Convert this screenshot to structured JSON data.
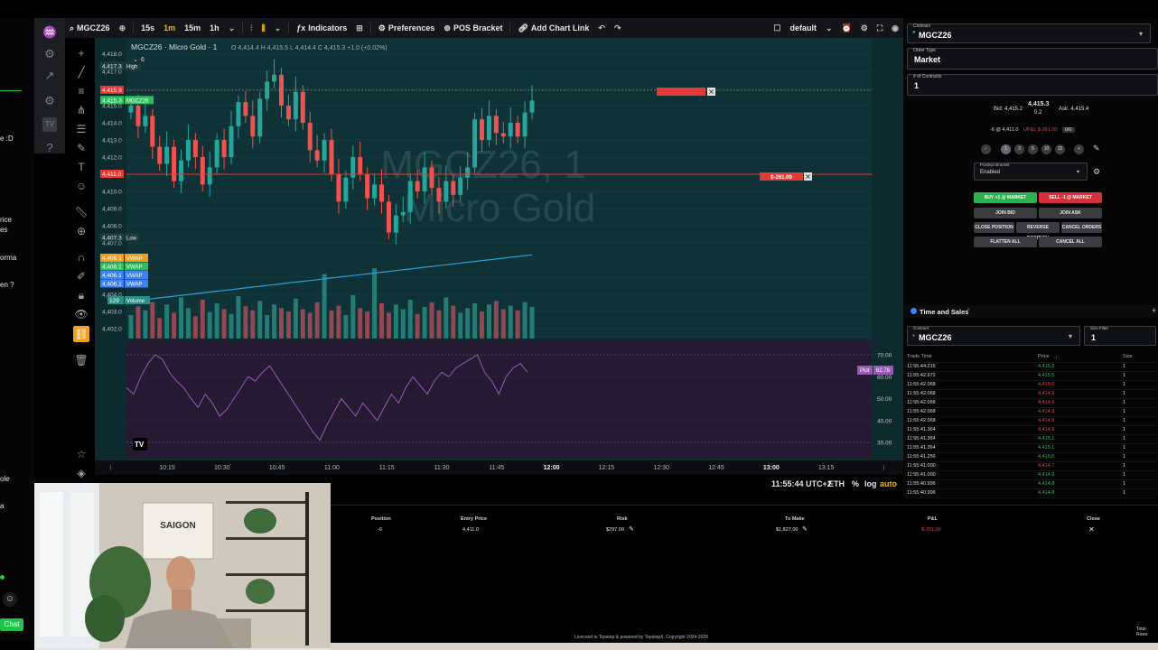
{
  "left_strip": {
    "fragments": [
      "e :D",
      "rice",
      "es",
      "orma",
      "en ?",
      "ole",
      "a"
    ],
    "chat_label": "Chat",
    "emoji": "☺"
  },
  "toolbar": {
    "symbol": "MGCZ26",
    "intervals": [
      "15s",
      "1m",
      "15m",
      "1h"
    ],
    "active_interval": "1m",
    "indicators_label": "Indicators",
    "preferences_label": "Preferences",
    "pos_bracket_label": "POS Bracket",
    "add_chart_link_label": "Add Chart Link",
    "layout_name": "default"
  },
  "chart": {
    "legend_title": "MGCZ26 · Micro Gold · 1",
    "ohlc": "O 4,414.4  H 4,415.5  L 4,414.4  C 4,415.3  +1.0 (+0.02%)",
    "indicator_count": "6",
    "watermark_line1": "MGCZ26, 1",
    "watermark_line2": "Micro Gold",
    "price_ticks": [
      "4,418.0",
      "4,417.0",
      "4,416.0",
      "4,415.0",
      "4,414.0",
      "4,413.0",
      "4,412.0",
      "4,411.0",
      "4,410.0",
      "4,409.0",
      "4,408.0",
      "4,407.0",
      "4,406.0",
      "4,405.0",
      "4,404.0",
      "4,403.0",
      "4,402.0"
    ],
    "top_tick": "4,418.0",
    "high_label": "4,417.3",
    "high_text": "High",
    "low_label": "4,407.3",
    "low_text": "Low",
    "order_label": "4,415.9",
    "last_price": "4,415.3",
    "last_symbol": "MGCZ26",
    "position_price": "4,411.0",
    "pnl_tag": "$-261.00",
    "vwap_tags": [
      {
        "value": "4,406.1",
        "label": "VWAP",
        "color": "#f29d1d"
      },
      {
        "value": "4,406.1",
        "label": "VWAP",
        "color": "#2ebd5f"
      },
      {
        "value": "4,406.1",
        "label": "VWAP",
        "color": "#3b82f6"
      },
      {
        "value": "4,406.1",
        "label": "VWAP",
        "color": "#3b82f6"
      }
    ],
    "volume_tag": {
      "value": "129",
      "label": "Volume"
    },
    "rsi": {
      "label": "Plot",
      "value": "62.78",
      "ticks": [
        "70.00",
        "60.00",
        "50.00",
        "40.00",
        "30.00"
      ]
    },
    "time_ticks": [
      "10:15",
      "10:30",
      "10:45",
      "11:00",
      "11:15",
      "11:30",
      "11:45",
      "12:00",
      "12:15",
      "12:30",
      "12:45",
      "13:00",
      "13:15"
    ],
    "bold_time": "12:00",
    "bold_time_2": "13:00",
    "status": {
      "clock": "11:55:44 UTC+2",
      "session": "ETH",
      "percent": "%",
      "log": "log",
      "auto": "auto"
    },
    "colors": {
      "up": "#26a69a",
      "down": "#ef5350",
      "vwap": "#2e9fd8",
      "rsi": "#9b59b6"
    },
    "candles": {
      "opens": [
        4414.6,
        4415.0,
        4413.8,
        4414.4,
        4412.6,
        4411.6,
        4412.6,
        4410.6,
        4411.8,
        4413.0,
        4412.0,
        4410.4,
        4411.4,
        4413.0,
        4412.0,
        4413.8,
        4415.2,
        4414.4,
        4413.2,
        4415.4,
        4416.4,
        4416.8,
        4415.0,
        4414.2,
        4415.8,
        4414.0,
        4412.4,
        4411.8,
        4413.0,
        4411.0,
        4409.4,
        4410.8,
        4412.0,
        4411.0,
        4409.6,
        4410.4,
        4409.4,
        4407.6,
        4408.6,
        4408.8,
        4410.6,
        4410.0,
        4411.4,
        4410.2,
        4409.4,
        4410.6,
        4409.8,
        4410.8,
        4411.4,
        4414.2,
        4413.0,
        4414.4,
        4413.4,
        4413.2,
        4414.0,
        4413.2,
        4414.6
      ],
      "closes": [
        4415.0,
        4413.8,
        4414.4,
        4412.6,
        4411.6,
        4412.6,
        4410.6,
        4411.8,
        4413.0,
        4412.0,
        4410.4,
        4411.4,
        4413.0,
        4412.0,
        4413.8,
        4415.2,
        4414.4,
        4413.2,
        4415.4,
        4416.4,
        4416.8,
        4415.0,
        4414.2,
        4415.8,
        4414.0,
        4412.4,
        4411.8,
        4413.0,
        4411.0,
        4409.4,
        4410.8,
        4412.0,
        4411.0,
        4409.6,
        4410.4,
        4409.4,
        4407.6,
        4408.6,
        4408.8,
        4410.6,
        4410.0,
        4411.4,
        4410.2,
        4409.4,
        4410.6,
        4409.8,
        4410.8,
        4411.4,
        4414.2,
        4413.0,
        4414.4,
        4413.4,
        4413.2,
        4414.0,
        4413.2,
        4414.6,
        4415.3
      ]
    },
    "volumes": [
      40,
      55,
      48,
      62,
      35,
      58,
      44,
      70,
      52,
      38,
      66,
      45,
      60,
      50,
      42,
      72,
      55,
      48,
      64,
      40,
      58,
      52,
      46,
      68,
      50,
      44,
      62,
      110,
      48,
      56,
      40,
      74,
      52,
      46,
      120,
      60,
      44,
      58,
      50,
      66,
      42,
      54,
      62,
      48,
      70,
      56,
      44,
      52,
      60,
      46,
      58,
      64,
      50,
      56,
      48,
      62,
      54
    ],
    "rsi_values": [
      55,
      52,
      60,
      66,
      70,
      68,
      62,
      58,
      55,
      50,
      46,
      52,
      48,
      42,
      45,
      50,
      55,
      60,
      58,
      62,
      65,
      60,
      55,
      50,
      45,
      40,
      35,
      31,
      38,
      44,
      50,
      46,
      42,
      48,
      44,
      40,
      46,
      52,
      48,
      55,
      60,
      56,
      52,
      58,
      62,
      60,
      64,
      66,
      68,
      70,
      62,
      58,
      52,
      60,
      64,
      66,
      62
    ]
  },
  "order_panel": {
    "contract_label": "Contract",
    "contract": "MGCZ26",
    "order_type_label": "Order Type",
    "order_type": "Market",
    "contracts_label": "# of Contracts",
    "contracts": "1",
    "bid": "Bid: 4,415.2",
    "last": "4,415.3",
    "spread": "0.2",
    "ask": "Ask: 4,415.4",
    "position": "-6 @ 4,411.0",
    "upnl": "UP&L $-261.00",
    "pnl_badge": "0/0",
    "qty_buttons": [
      "−",
      "1",
      "3",
      "5",
      "10",
      "15",
      "+"
    ],
    "bracket_label": "Position Bracket",
    "bracket_value": "Enabled",
    "buy_btn": "BUY +1 @ MARKET",
    "sell_btn": "SELL -1 @ MARKET",
    "join_bid": "JOIN BID",
    "join_ask": "JOIN ASK",
    "close_position": "CLOSE POSITION",
    "reverse_position": "REVERSE POSITION",
    "cancel_orders": "CANCEL ORDERS",
    "flatten_all": "FLATTEN ALL",
    "cancel_all": "CANCEL ALL"
  },
  "time_sales": {
    "title": "Time and Sales",
    "contract_label": "Contract",
    "contract": "MGCZ26",
    "size_filter_label": "Size Filter",
    "size_filter": "1",
    "columns": [
      "Trade Time",
      "Price",
      "Size"
    ],
    "rows": [
      {
        "time": "11:55:44.216",
        "price": "4,415.3",
        "size": "1",
        "side": "up"
      },
      {
        "time": "11:55:42.972",
        "price": "4,415.5",
        "size": "1",
        "side": "up"
      },
      {
        "time": "11:55:42.068",
        "price": "4,415.0",
        "size": "1",
        "side": "down"
      },
      {
        "time": "11:55:42.068",
        "price": "4,414.9",
        "size": "1",
        "side": "down"
      },
      {
        "time": "11:55:42.068",
        "price": "4,414.9",
        "size": "1",
        "side": "down"
      },
      {
        "time": "11:55:42.068",
        "price": "4,414.9",
        "size": "1",
        "side": "down"
      },
      {
        "time": "11:55:42.068",
        "price": "4,414.9",
        "size": "1",
        "side": "down"
      },
      {
        "time": "11:55:41.364",
        "price": "4,414.9",
        "size": "1",
        "side": "down"
      },
      {
        "time": "11:55:41.364",
        "price": "4,415.1",
        "size": "1",
        "side": "up"
      },
      {
        "time": "11:55:41.364",
        "price": "4,415.1",
        "size": "1",
        "side": "up"
      },
      {
        "time": "11:55:41.256",
        "price": "4,415.0",
        "size": "1",
        "side": "up"
      },
      {
        "time": "11:55:41.000",
        "price": "4,414.7",
        "size": "1",
        "side": "down"
      },
      {
        "time": "11:55:41.000",
        "price": "4,414.9",
        "size": "1",
        "side": "up"
      },
      {
        "time": "11:55:40.996",
        "price": "4,414.8",
        "size": "1",
        "side": "up"
      },
      {
        "time": "11:55:40.996",
        "price": "4,414.8",
        "size": "1",
        "side": "up"
      },
      {
        "time": "11:55:40.992",
        "price": "4,414.7",
        "size": "1",
        "side": "up"
      }
    ],
    "colors": {
      "up": "#2ebd5f",
      "down": "#e0424c"
    }
  },
  "positions": {
    "columns": [
      "Position",
      "Entry Price",
      "Risk",
      "To Make",
      "P&L",
      "Close"
    ],
    "row": {
      "position": "-6",
      "entry": "4,411.0",
      "risk": "$297.00",
      "to_make": "$1,827.00",
      "pnl": "$-261.00",
      "close": "✕"
    },
    "footer": "Licensed to Topstep & powered by TopstepX. Copyright 2024-2026",
    "total": "Total Rows"
  },
  "webcam": {
    "sign": "SAIGON"
  }
}
